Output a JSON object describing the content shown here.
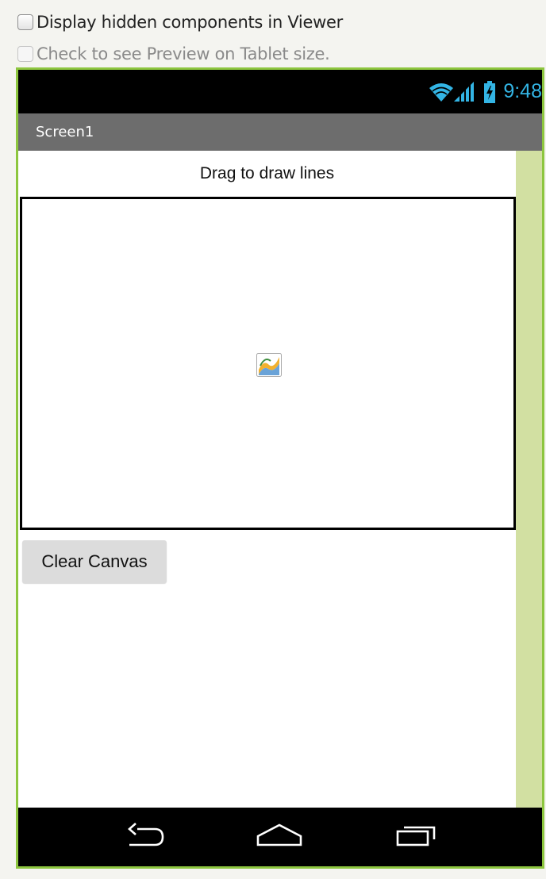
{
  "options": {
    "show_hidden_label": "Display hidden components in Viewer",
    "tablet_preview_label": "Check to see Preview on Tablet size."
  },
  "status_bar": {
    "time": "9:48",
    "icons": [
      "wifi-icon",
      "signal-icon",
      "battery-charging-icon"
    ],
    "accent_color": "#33b5e5"
  },
  "screen": {
    "title": "Screen1"
  },
  "components": {
    "label_text": "Drag to draw lines",
    "canvas_icon": "canvas-icon",
    "button_text": "Clear Canvas"
  },
  "nav_bar": {
    "icons": [
      "back-icon",
      "home-icon",
      "recent-apps-icon"
    ]
  },
  "colors": {
    "phone_border": "#8dc63f",
    "title_bar": "#6d6d6d",
    "scroll_strip": "#d2e0a2",
    "button_bg": "#dcdcdc"
  }
}
